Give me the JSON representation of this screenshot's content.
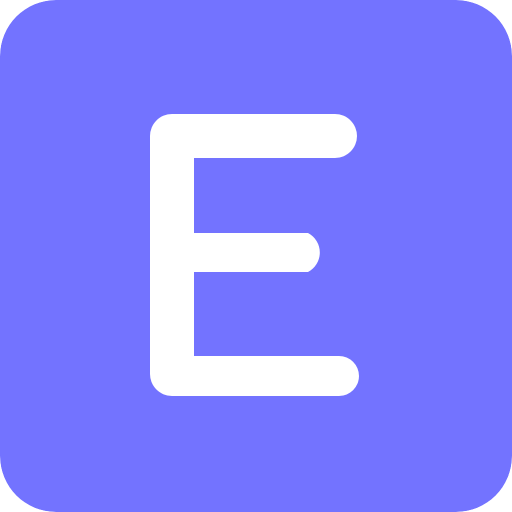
{
  "icon": {
    "name": "letter-e-app-icon",
    "letter": "E",
    "background_color": "#7373FF",
    "letter_color": "#FFFFFF"
  }
}
